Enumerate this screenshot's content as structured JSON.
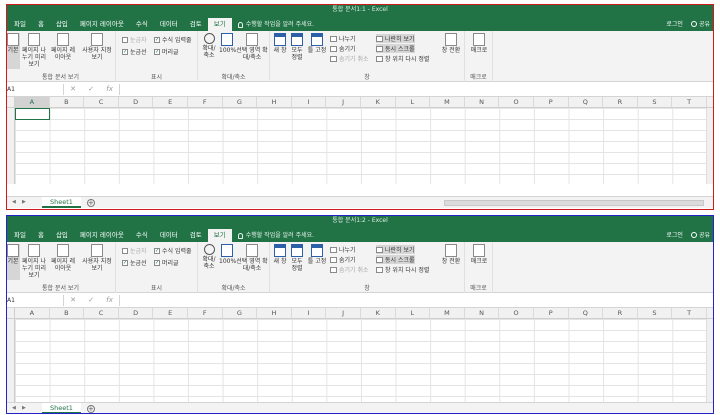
{
  "windows": [
    {
      "title": "통합 문서1:1 - Excel",
      "tabs": [
        "파일",
        "홈",
        "삽입",
        "페이지 레이아웃",
        "수식",
        "데이터",
        "검토",
        "보기"
      ],
      "active_tab": "보기",
      "tell_me": "수행할 작업을 알려 주세요.",
      "login": "로그인",
      "share": "공유",
      "name_box": "A1",
      "sheet_tab": "Sheet1",
      "accent": "#d11a1a"
    },
    {
      "title": "통합 문서1:2 - Excel",
      "tabs": [
        "파일",
        "홈",
        "삽입",
        "페이지 레이아웃",
        "수식",
        "데이터",
        "검토",
        "보기"
      ],
      "active_tab": "보기",
      "tell_me": "수행할 작업을 알려 주세요.",
      "login": "로그인",
      "share": "공유",
      "name_box": "A1",
      "sheet_tab": "Sheet1",
      "accent": "#2323c8"
    }
  ],
  "ribbon": {
    "workbook_views": {
      "label": "통합 문서 보기",
      "normal": "기본",
      "page_break": "페이지 나누기 미리 보기",
      "page_layout": "페이지 레이아웃",
      "custom": "사용자 지정 보기"
    },
    "show": {
      "label": "표시",
      "ruler": "눈금자",
      "formula_bar": "수식 입력줄",
      "gridlines": "눈금선",
      "headings": "머리글"
    },
    "zoom": {
      "label": "확대/축소",
      "zoom": "확대/축소",
      "hundred": "100%",
      "selection": "선택 영역 확대/축소"
    },
    "window": {
      "label": "창",
      "new_window": "새 창",
      "arrange_all": "모두 정렬",
      "freeze": "틀 고정",
      "split": "나누기",
      "hide": "숨기기",
      "unhide": "숨기기 취소",
      "side_by_side": "나란히 보기",
      "sync_scroll": "동시 스크롤",
      "reset_position": "창 위치 다시 정렬",
      "switch": "창 전환"
    },
    "macros": {
      "label": "매크로",
      "macros": "매크로"
    }
  },
  "columns": [
    "A",
    "B",
    "C",
    "D",
    "E",
    "F",
    "G",
    "H",
    "I",
    "J",
    "K",
    "L",
    "M",
    "N",
    "O",
    "P",
    "Q",
    "R",
    "S",
    "T"
  ]
}
